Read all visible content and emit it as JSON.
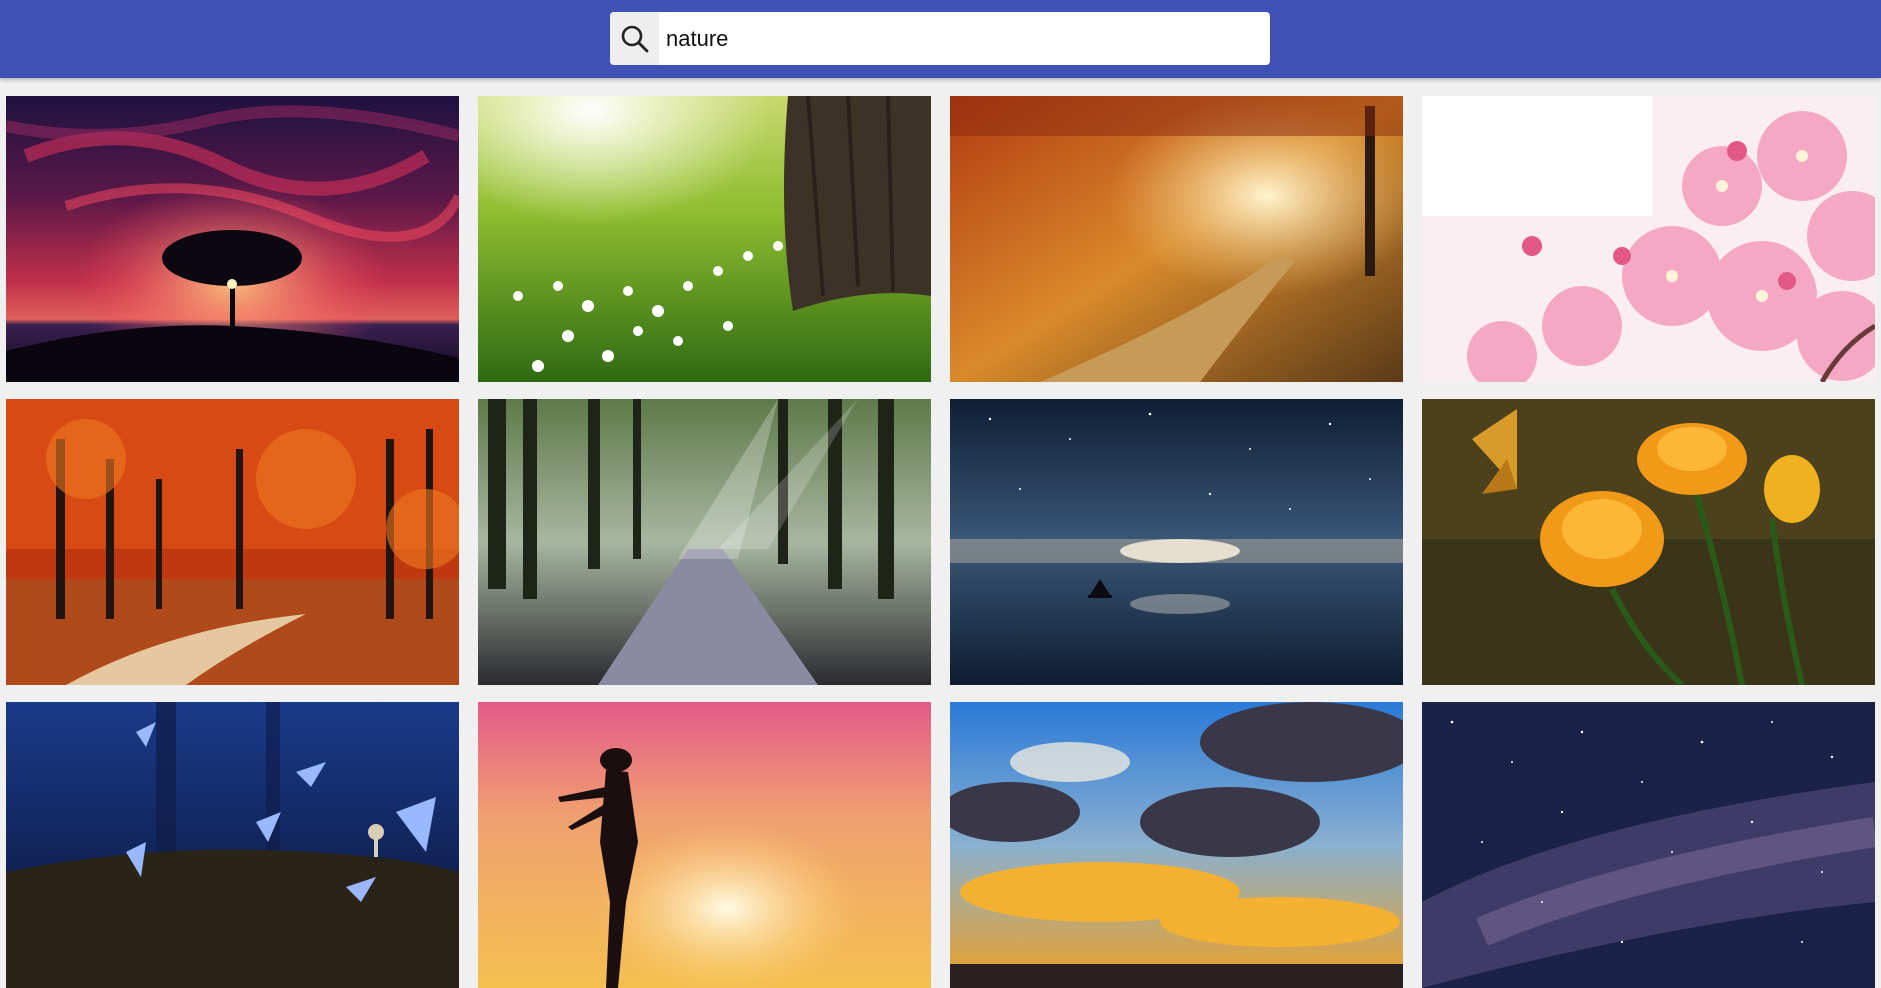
{
  "search": {
    "value": "nature",
    "icon": "search-icon"
  },
  "colors": {
    "header_background": "#3f51b5",
    "page_background": "#f0f0f0",
    "search_icon_background": "#eeeeee"
  },
  "results": [
    {
      "name": "sunset-tree-photo"
    },
    {
      "name": "sunlit-meadow-flowers-photo"
    },
    {
      "name": "autumn-forest-path-photo"
    },
    {
      "name": "cherry-blossom-photo"
    },
    {
      "name": "red-autumn-forest-photo"
    },
    {
      "name": "misty-forest-road-photo"
    },
    {
      "name": "starry-sea-sailboat-photo"
    },
    {
      "name": "butterfly-orange-flowers-photo"
    },
    {
      "name": "blue-butterflies-forest-photo"
    },
    {
      "name": "woman-sunset-silhouette-photo"
    },
    {
      "name": "dramatic-sky-clouds-photo"
    },
    {
      "name": "milky-way-stars-photo"
    }
  ]
}
